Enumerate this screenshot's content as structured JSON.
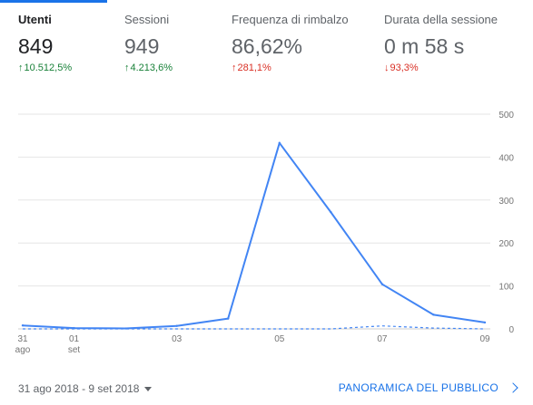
{
  "kpis": [
    {
      "label": "Utenti",
      "value": "849",
      "change_arrow": "↑",
      "change": "10.512,5%",
      "trend": "up",
      "color": "#188038"
    },
    {
      "label": "Sessioni",
      "value": "949",
      "change_arrow": "↑",
      "change": "4.213,6%",
      "trend": "up",
      "color": "#188038"
    },
    {
      "label": "Frequenza di rimbalzo",
      "value": "86,62%",
      "change_arrow": "↑",
      "change": "281,1%",
      "trend": "up",
      "color": "#d93025"
    },
    {
      "label": "Durata della sessione",
      "value": "0 m 58 s",
      "change_arrow": "↓",
      "change": "93,3%",
      "trend": "down",
      "color": "#d93025"
    }
  ],
  "chart_data": {
    "type": "line",
    "x": [
      "31 ago",
      "01 set",
      "02 set",
      "03 set",
      "04 set",
      "05 set",
      "06 set",
      "07 set",
      "08 set",
      "09 set"
    ],
    "x_tick_labels": [
      {
        "index": 0,
        "lines": [
          "31",
          "ago"
        ]
      },
      {
        "index": 1,
        "lines": [
          "01",
          "set"
        ]
      },
      {
        "index": 3,
        "lines": [
          "03"
        ]
      },
      {
        "index": 5,
        "lines": [
          "05"
        ]
      },
      {
        "index": 7,
        "lines": [
          "07"
        ]
      },
      {
        "index": 9,
        "lines": [
          "09"
        ]
      }
    ],
    "y_ticks": [
      0,
      100,
      200,
      300,
      400,
      500
    ],
    "ylim": [
      0,
      500
    ],
    "y_axis_position": "right",
    "grid": true,
    "series": [
      {
        "style": "solid",
        "color": "#4285f4",
        "values": [
          8,
          2,
          1,
          7,
          24,
          433,
          272,
          104,
          33,
          15
        ]
      },
      {
        "style": "dashed",
        "color": "#4285f4",
        "values": [
          0,
          0,
          0,
          0,
          0,
          0,
          0,
          7,
          2,
          0
        ]
      }
    ]
  },
  "footer": {
    "date_range": "31 ago 2018 - 9 set 2018",
    "report_link": "PANORAMICA DEL PUBBLICO"
  },
  "icons": {
    "dropdown": "caret-down-icon",
    "link": "chevron-right-icon"
  }
}
